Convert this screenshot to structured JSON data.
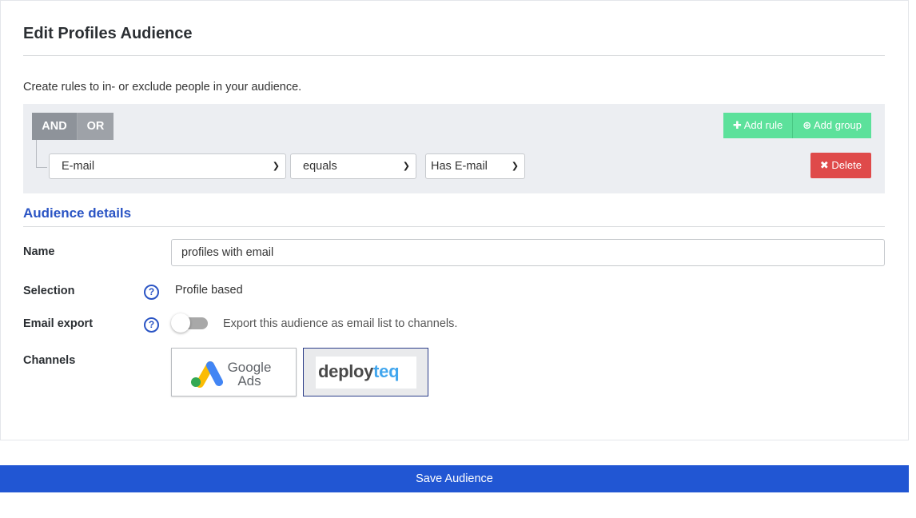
{
  "page": {
    "title": "Edit Profiles Audience",
    "intro": "Create rules to in- or exclude people in your audience."
  },
  "rules": {
    "logic_and": "AND",
    "logic_or": "OR",
    "add_rule_label": "Add rule",
    "add_group_label": "Add group",
    "delete_label": "Delete",
    "field_value": "E-mail",
    "operator_value": "equals",
    "value_value": "Has E-mail",
    "add_icon": "plus-icon",
    "group_icon": "plus-circle-icon",
    "delete_icon": "x-icon"
  },
  "details": {
    "section_title": "Audience details",
    "name_label": "Name",
    "name_value": "profiles with email",
    "selection_label": "Selection",
    "selection_value": "Profile based",
    "email_export_label": "Email export",
    "email_export_text": "Export this audience as email list to channels.",
    "email_export_enabled": false,
    "channels_label": "Channels",
    "channels": [
      {
        "name": "Google Ads",
        "line1": "Google",
        "line2": "Ads",
        "selected": false
      },
      {
        "name": "deployteq",
        "part1": "deploy",
        "part2": "teq",
        "selected": true
      }
    ]
  },
  "footer": {
    "save_label": "Save Audience"
  },
  "colors": {
    "accent_blue": "#2156d3",
    "section_blue": "#2a54c4",
    "green": "#5ce19b",
    "red": "#df4a4a",
    "logic_gray": "#8e939a"
  }
}
